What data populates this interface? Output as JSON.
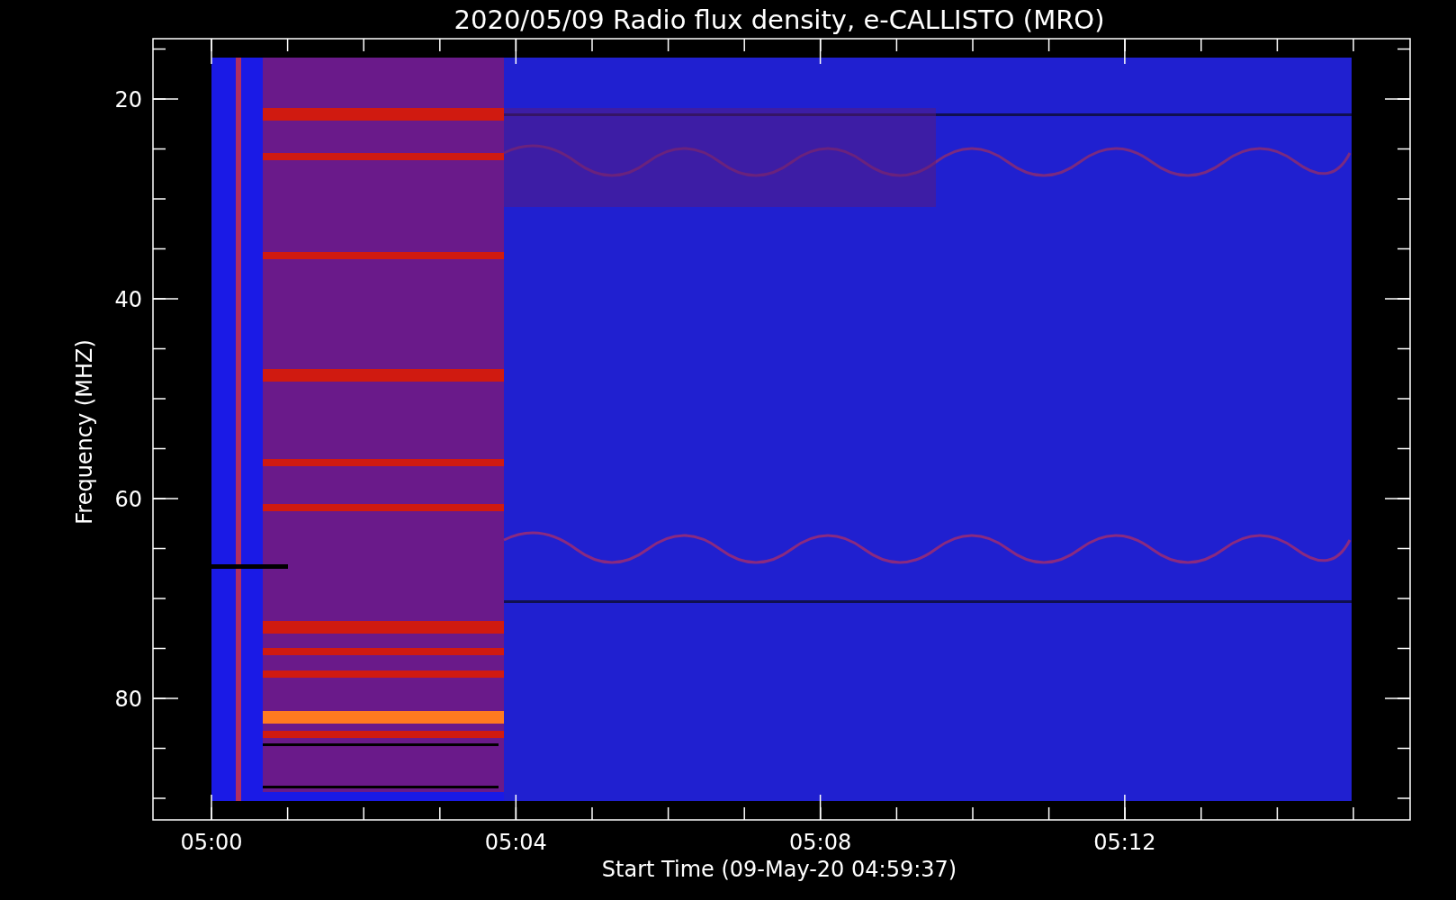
{
  "title": "2020/05/09  Radio flux density, e-CALLISTO (MRO)",
  "plot": {
    "ylabel": "Frequency (MHZ)",
    "xlabel": "Start Time (09-May-20 04:59:37)",
    "yticks": [
      "20",
      "40",
      "60",
      "80"
    ],
    "xticks": [
      "05:00",
      "05:04",
      "05:08",
      "05:12"
    ]
  }
}
